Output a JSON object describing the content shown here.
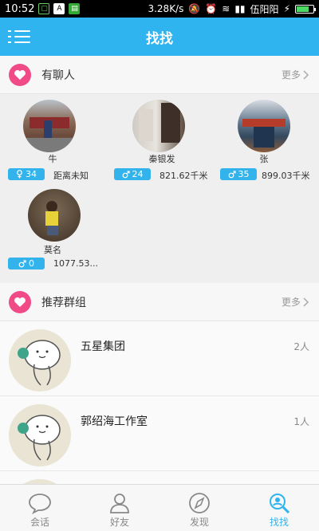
{
  "status_bar": {
    "time": "10:52",
    "speed": "3.28K/s",
    "carrier": "伍阳阳"
  },
  "header": {
    "title": "找找"
  },
  "nearby_section": {
    "title": "有聊人",
    "more_label": "更多"
  },
  "people": [
    {
      "name": "牛",
      "gender_icon": "female-icon",
      "age": "34",
      "distance": "距离未知"
    },
    {
      "name": "秦银发",
      "gender_icon": "male-icon",
      "age": "24",
      "distance": "821.62千米"
    },
    {
      "name": "张",
      "gender_icon": "male-icon",
      "age": "35",
      "distance": "899.03千米"
    },
    {
      "name": "莫名",
      "gender_icon": "male-icon",
      "age": "0",
      "distance": "1077.53..."
    }
  ],
  "groups_section": {
    "title": "推荐群组",
    "more_label": "更多"
  },
  "groups": [
    {
      "name": "五星集团",
      "count": "2人"
    },
    {
      "name": "郭绍海工作室",
      "count": "1人"
    }
  ],
  "bottom_nav": {
    "tabs": [
      {
        "label": "会话",
        "icon": "chat-icon",
        "active": false
      },
      {
        "label": "好友",
        "icon": "friends-icon",
        "active": false
      },
      {
        "label": "发现",
        "icon": "compass-icon",
        "active": false
      },
      {
        "label": "找找",
        "icon": "search-person-icon",
        "active": true
      }
    ]
  },
  "colors": {
    "accent": "#2fb4f0",
    "heart": "#f04b86",
    "badge": "#33b3ec"
  }
}
